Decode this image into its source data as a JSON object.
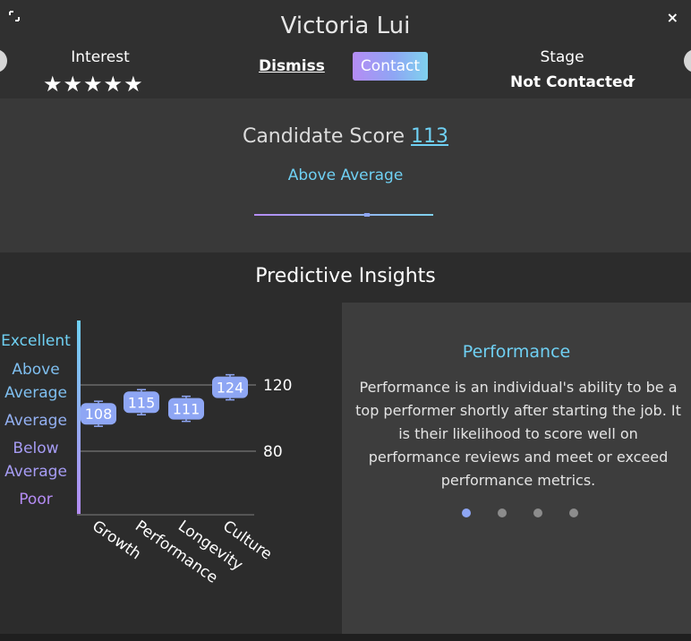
{
  "header": {
    "candidate_name": "Victoria Lui",
    "interest_label": "Interest",
    "stars": "★★★★★",
    "rating_value": 5,
    "dismiss_label": "Dismiss",
    "contact_label": "Contact",
    "stage_label": "Stage",
    "stage_value": "Not Contacted",
    "close_glyph": "×"
  },
  "score": {
    "label": "Candidate Score",
    "value": "113",
    "rating": "Above Average"
  },
  "insights": {
    "title": "Predictive Insights",
    "levels": [
      "Excellent",
      "Above Average",
      "Average",
      "Below Average",
      "Poor"
    ],
    "detail": {
      "title": "Performance",
      "text": "Performance is an individual's ability to be a top performer shortly after starting the job. It is their likelihood to score well on performance reviews and meet or exceed performance metrics.",
      "pages": 4,
      "active_page": 1
    }
  },
  "chart_data": {
    "type": "scatter",
    "categories": [
      "Growth",
      "Performance",
      "Longevity",
      "Culture"
    ],
    "values": [
      108,
      115,
      111,
      124
    ],
    "reference_lines": [
      120,
      80
    ],
    "y_labels": [
      "Excellent",
      "Above Average",
      "Average",
      "Below Average",
      "Poor"
    ],
    "colors": {
      "point": "#8ea6f4",
      "accent": "#6fd0f3",
      "purple": "#b58cf4"
    }
  }
}
